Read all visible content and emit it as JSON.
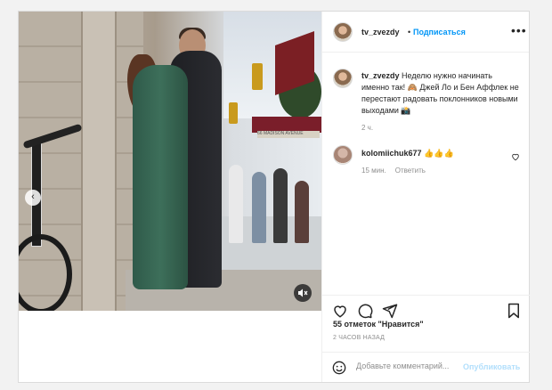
{
  "post": {
    "username": "tv_zvezdy",
    "follow_label": "Подписаться",
    "more_label": "•••",
    "caption": "Неделю нужно начинать именно так! 🙈 Джей Ло и Бен Аффлек не перестают радовать поклонников новыми выходами 📸",
    "caption_time": "2 ч.",
    "comment": {
      "username": "kolomiichuk677",
      "text": "👍👍👍",
      "time": "15 мин.",
      "reply_label": "Ответить"
    },
    "likes": "55 отметок \"Нравится\"",
    "posted_ago": "2 ЧАСОВ НАЗАД",
    "comment_placeholder": "Добавьте комментарий...",
    "publish_label": "Опубликовать",
    "awning_sign": "66 MADISON AVENUE"
  },
  "icons": [
    "chevron-left-icon",
    "volume-muted-icon",
    "more-icon",
    "heart-icon",
    "comment-icon",
    "share-icon",
    "bookmark-icon",
    "emoji-icon"
  ]
}
